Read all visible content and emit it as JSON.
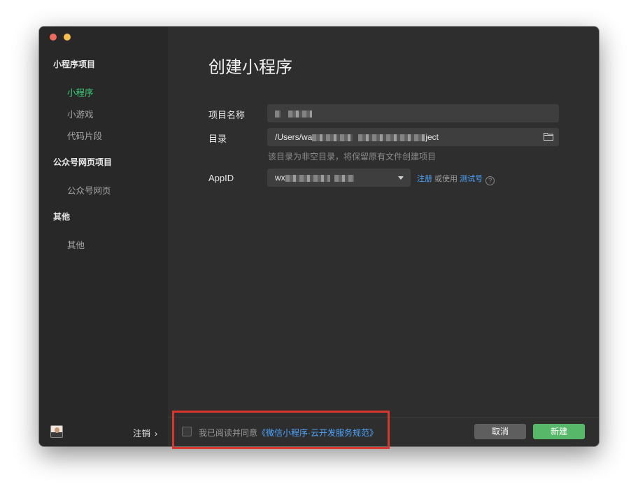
{
  "sidebar": {
    "sections": [
      {
        "title": "小程序项目",
        "items": [
          "小程序",
          "小游戏",
          "代码片段"
        ]
      },
      {
        "title": "公众号网页项目",
        "items": [
          "公众号网页"
        ]
      },
      {
        "title": "其他",
        "items": [
          "其他"
        ]
      }
    ],
    "active_item": "小程序",
    "logout_label": "注销",
    "logout_chevron": "›"
  },
  "main": {
    "title": "创建小程序",
    "project_name_label": "项目名称",
    "directory_label": "目录",
    "directory_value_prefix": "/Users/wa",
    "directory_value_suffix": "ject",
    "directory_hint": "该目录为非空目录，将保留原有文件创建项目",
    "appid_label": "AppID",
    "appid_value_prefix": "wx",
    "register_link": "注册",
    "or_use_text": " 或使用 ",
    "test_account_link": "测试号",
    "help_glyph": "?"
  },
  "footer": {
    "agree_text": "我已阅读并同意",
    "agreement_link": "《微信小程序·云开发服务规范》",
    "cancel_label": "取消",
    "create_label": "新建"
  },
  "colors": {
    "accent_green": "#3fd07b",
    "link_blue": "#4ea6ff",
    "create_button": "#58b86a",
    "highlight_red": "#d7372c"
  }
}
